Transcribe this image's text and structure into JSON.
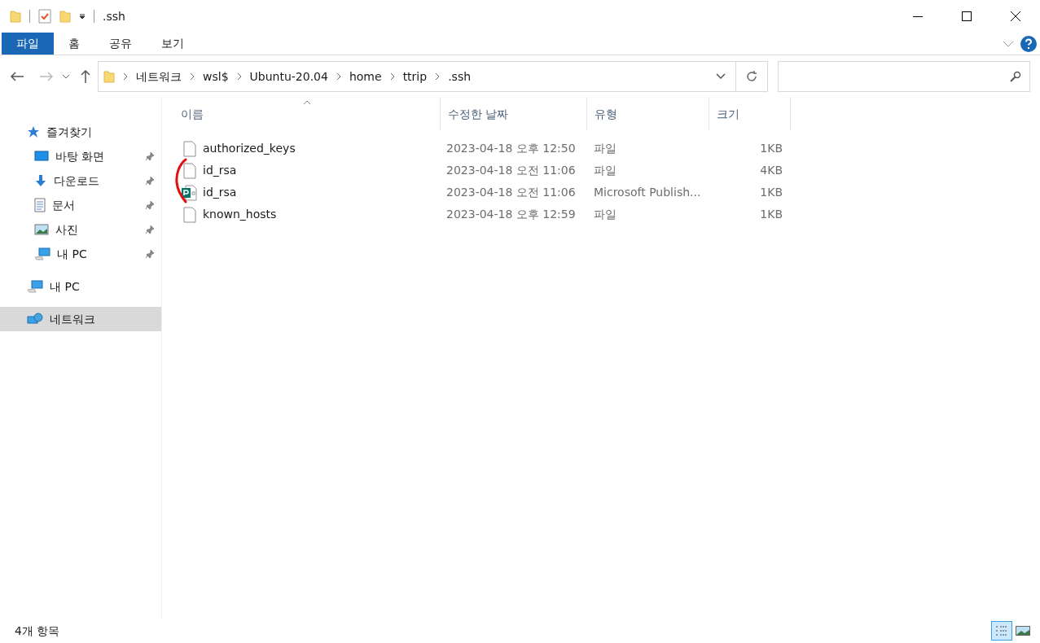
{
  "window": {
    "title": ".ssh"
  },
  "ribbon_tabs": [
    {
      "label": "파일",
      "selected": true
    },
    {
      "label": "홈",
      "selected": false
    },
    {
      "label": "공유",
      "selected": false
    },
    {
      "label": "보기",
      "selected": false
    }
  ],
  "address_bar": {
    "path": [
      "네트워크",
      "wsl$",
      "Ubuntu-20.04",
      "home",
      "ttrip",
      ".ssh"
    ]
  },
  "sidebar": {
    "items": [
      {
        "label": "즐겨찾기",
        "selected": false,
        "children": [
          {
            "label": "바탕 화면",
            "pinned": true,
            "selected": false
          },
          {
            "label": "다운로드",
            "pinned": true,
            "selected": false
          },
          {
            "label": "문서",
            "pinned": true,
            "selected": false
          },
          {
            "label": "사진",
            "pinned": true,
            "selected": false
          },
          {
            "label": "내 PC",
            "pinned": true,
            "selected": false
          }
        ]
      },
      {
        "label": "내 PC",
        "selected": false
      },
      {
        "label": "네트워크",
        "selected": true
      }
    ]
  },
  "table": {
    "columns": [
      {
        "label": "이름",
        "sorted": true
      },
      {
        "label": "수정한 날짜",
        "sorted": false
      },
      {
        "label": "유형",
        "sorted": false
      },
      {
        "label": "크기",
        "sorted": false
      }
    ],
    "rows": [
      {
        "kind": "file",
        "name": "authorized_keys",
        "date": "2023-04-18 오후 12:50",
        "type": "파일",
        "size": "1KB"
      },
      {
        "kind": "file",
        "name": "id_rsa",
        "date": "2023-04-18 오전 11:06",
        "type": "파일",
        "size": "4KB"
      },
      {
        "kind": "publisher",
        "name": "id_rsa",
        "date": "2023-04-18 오전 11:06",
        "type": "Microsoft Publish...",
        "size": "1KB"
      },
      {
        "kind": "file",
        "name": "known_hosts",
        "date": "2023-04-18 오후 12:59",
        "type": "파일",
        "size": "1KB"
      }
    ]
  },
  "status_bar": {
    "text": "4개 항목",
    "views": [
      {
        "kind": "details",
        "selected": true
      },
      {
        "kind": "large",
        "selected": false
      }
    ]
  }
}
